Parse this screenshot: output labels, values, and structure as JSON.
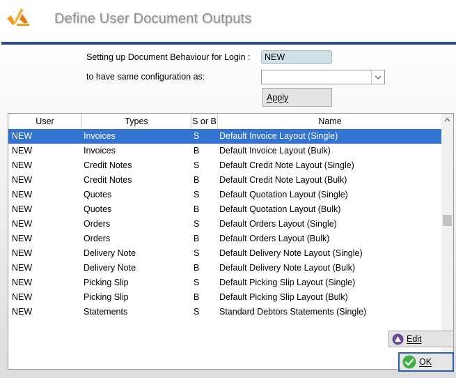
{
  "header": {
    "title": "Define User Document Outputs"
  },
  "form": {
    "login_label": "Setting up Document Behaviour for Login :",
    "login_value": "NEW",
    "copy_label": "to have same configuration as:",
    "copy_value": "",
    "apply_label": "Apply"
  },
  "table": {
    "columns": [
      "User",
      "Types",
      "S or B",
      "Name"
    ],
    "rows": [
      {
        "user": "NEW",
        "type": "Invoices",
        "sb": "S",
        "name": "Default Invoice Layout (Single)"
      },
      {
        "user": "NEW",
        "type": "Invoices",
        "sb": "B",
        "name": "Default Invoice Layout (Bulk)"
      },
      {
        "user": "NEW",
        "type": "Credit Notes",
        "sb": "S",
        "name": "Default Credit Note Layout (Single)"
      },
      {
        "user": "NEW",
        "type": "Credit Notes",
        "sb": "B",
        "name": "Default Credit Note Layout (Bulk)"
      },
      {
        "user": "NEW",
        "type": "Quotes",
        "sb": "S",
        "name": "Default Quotation Layout (Single)"
      },
      {
        "user": "NEW",
        "type": "Quotes",
        "sb": "B",
        "name": "Default Quotation Layout (Bulk)"
      },
      {
        "user": "NEW",
        "type": "Orders",
        "sb": "S",
        "name": "Default Orders Layout (Single)"
      },
      {
        "user": "NEW",
        "type": "Orders",
        "sb": "B",
        "name": "Default Orders Layout (Bulk)"
      },
      {
        "user": "NEW",
        "type": "Delivery Note",
        "sb": "S",
        "name": "Default Delivery Note Layout (Single)"
      },
      {
        "user": "NEW",
        "type": "Delivery Note",
        "sb": "B",
        "name": "Default Delivery Note Layout (Bulk)"
      },
      {
        "user": "NEW",
        "type": "Picking Slip",
        "sb": "S",
        "name": "Default Picking Slip Layout (Single)"
      },
      {
        "user": "NEW",
        "type": "Picking Slip",
        "sb": "B",
        "name": "Default Picking Slip Layout (Bulk)"
      },
      {
        "user": "NEW",
        "type": "Statements",
        "sb": "S",
        "name": "Standard Debtors Statements (Single)"
      }
    ],
    "selected_row": 0
  },
  "buttons": {
    "edit_label": "Edit",
    "ok_label": "OK"
  },
  "colors": {
    "accent": "#2d4d8a",
    "selection": "#3373d2",
    "logo": "#f29a1f",
    "ok_icon": "#3cb043",
    "edit_icon": "#6a4c93"
  }
}
